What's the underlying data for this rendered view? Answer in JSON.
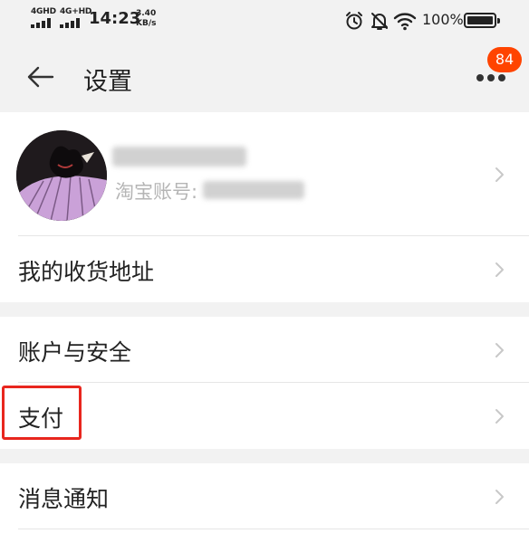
{
  "status_bar": {
    "network_1": "4GHD",
    "network_2": "4G+HD",
    "time": "14:23",
    "speed_value": "3.40",
    "speed_unit": "KB/s",
    "battery": "100%",
    "icons": [
      "alarm-icon",
      "mute-bell-icon",
      "wifi-icon",
      "battery-icon"
    ]
  },
  "header": {
    "title": "设置",
    "badge_count": "84"
  },
  "profile": {
    "account_label": "淘宝账号:"
  },
  "menu": {
    "address": "我的收货地址",
    "account_security": "账户与安全",
    "payment": "支付",
    "notifications": "消息通知"
  },
  "colors": {
    "badge": "#ff4400",
    "highlight": "#e8261e",
    "background": "#f2f2f2"
  }
}
